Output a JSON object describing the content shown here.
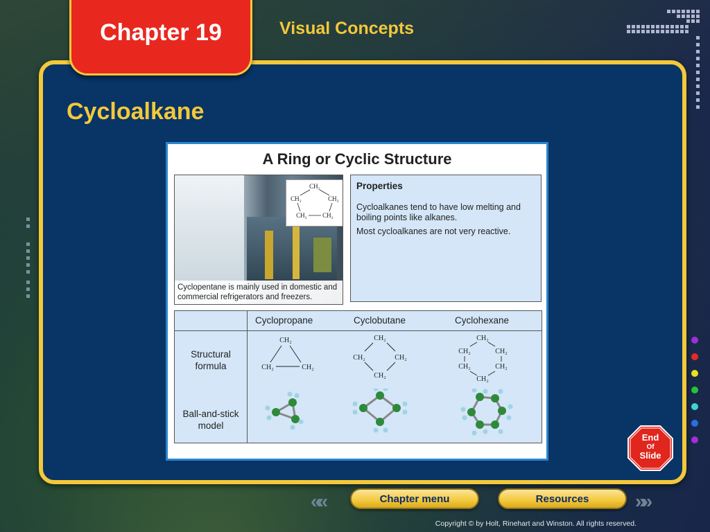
{
  "header": {
    "chapter_label": "Chapter 19",
    "section_label": "Visual Concepts"
  },
  "slide": {
    "title": "Cycloalkane"
  },
  "figure": {
    "title": "A Ring or Cyclic Structure",
    "photo_caption": "Cyclopentane is mainly used in domestic and commercial refrigerators and freezers.",
    "mini_structure": [
      "CH₂",
      "CH₂",
      "CH₂",
      "CH₂",
      "CH₂"
    ],
    "properties": {
      "heading": "Properties",
      "items": [
        "Cycloalkanes tend to have low melting and boiling points like alkanes.",
        "Most cycloalkanes are not very reactive."
      ]
    },
    "table": {
      "columns": [
        "Cyclopropane",
        "Cyclobutane",
        "Cyclohexane"
      ],
      "row_labels": [
        "Structural formula",
        "Ball-and-stick model"
      ],
      "struct_label": "CH₂"
    }
  },
  "end_slide": {
    "line1": "End",
    "line2": "Of",
    "line3": "Slide"
  },
  "nav": {
    "chapter_menu": "Chapter menu",
    "resources": "Resources",
    "back_arrows": "«",
    "forward_arrows": "»"
  },
  "footer": {
    "copyright": "Copyright © by Holt, Rinehart and Winston. All rights reserved."
  },
  "colors": {
    "accent_yellow": "#f3c83a",
    "chapter_red": "#e8281f",
    "panel_blue": "#083466",
    "dots": [
      "#9b30d8",
      "#e62a22",
      "#e7e21c",
      "#22c43a",
      "#3fd3d8",
      "#2a6fe0",
      "#a22fd8"
    ]
  }
}
